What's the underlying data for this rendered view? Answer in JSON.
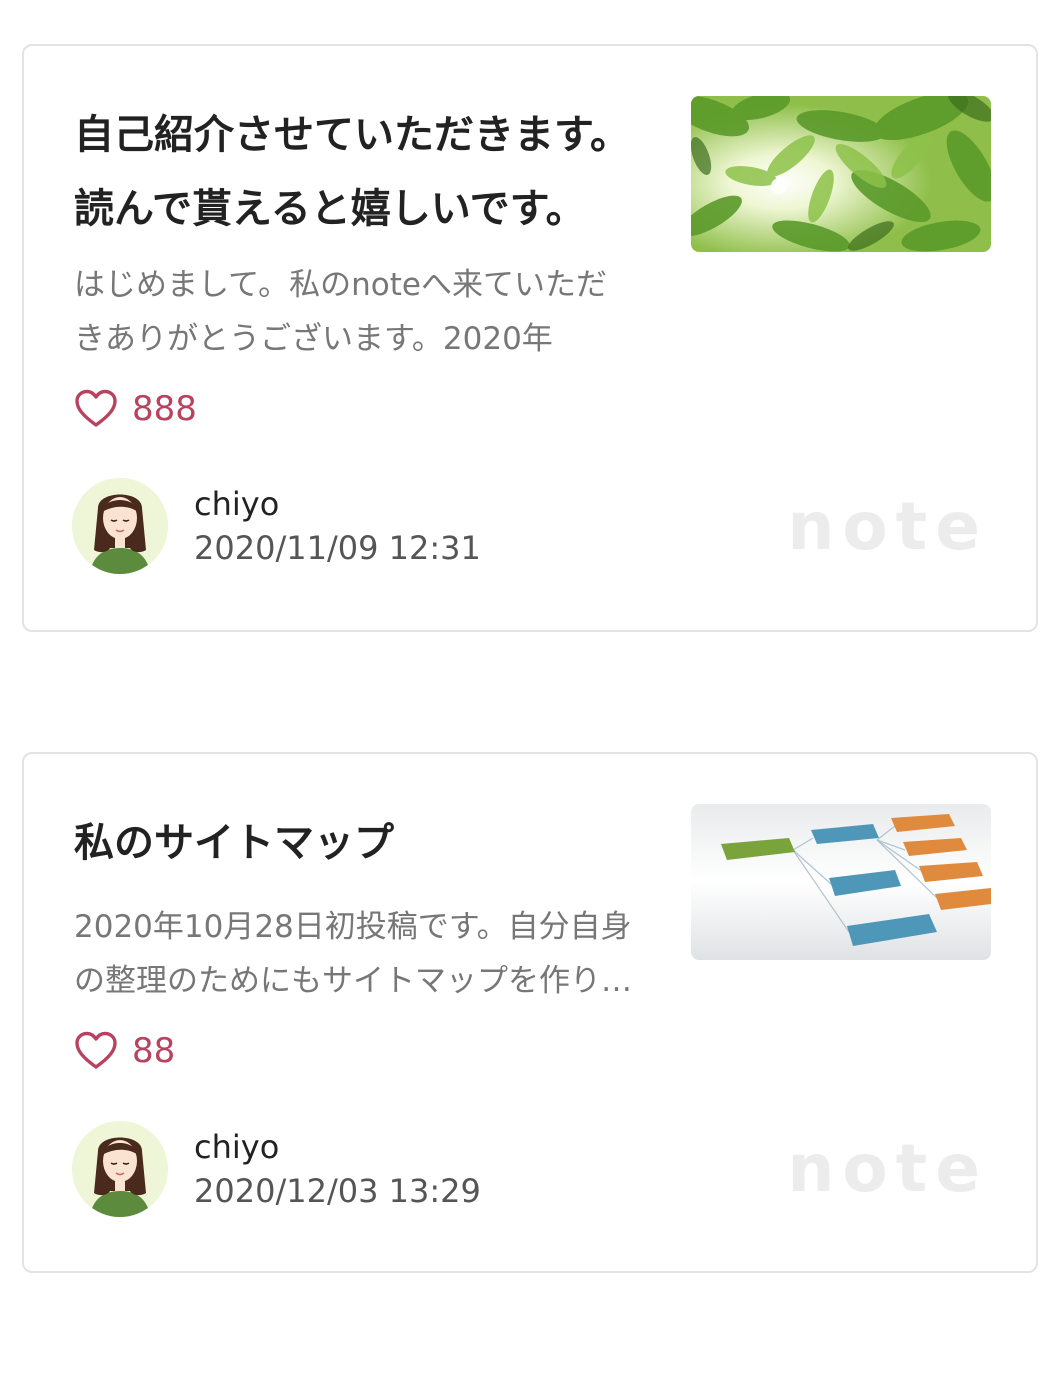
{
  "articles": [
    {
      "title": "自己紹介させていただきます。読んで貰えると嬉しいです。",
      "excerpt": "はじめまして。私のnoteへ来ていただきありがとうございます。2020年",
      "likes": "888",
      "author": "chiyo",
      "date": "2020/11/09 12:31",
      "thumbnail_icon": "leaves-sunlight-image",
      "logo": "note"
    },
    {
      "title": "私のサイトマップ",
      "excerpt": "2020年10月28日初投稿です。自分自身の整理のためにもサイトマップを作りました。",
      "likes": "88",
      "author": "chiyo",
      "date": "2020/12/03 13:29",
      "thumbnail_icon": "sitemap-diagram-image",
      "logo": "note"
    }
  ],
  "colors": {
    "like": "#b8435f",
    "border": "#e3e3e3",
    "title": "#222222",
    "excerpt": "#777777",
    "logo": "#ececec"
  }
}
